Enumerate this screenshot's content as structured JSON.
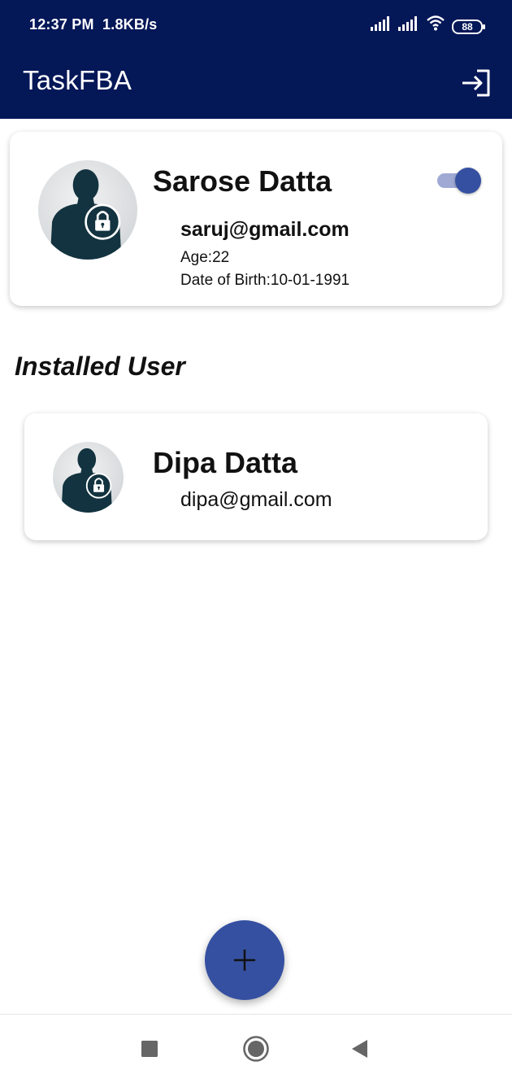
{
  "status_bar": {
    "time": "12:37 PM",
    "speed": "1.8KB/s",
    "battery": "88"
  },
  "app_bar": {
    "title": "TaskFBA",
    "logout_icon": "logout-icon"
  },
  "main_user": {
    "name": "Sarose Datta",
    "email": "saruj@gmail.com",
    "age": "Age:22",
    "dob": "Date of Birth:10-01-1991",
    "toggle_on": true
  },
  "installed_section": {
    "title": "Installed User"
  },
  "installed_users": [
    {
      "name": "Dipa Datta",
      "email": "dipa@gmail.com"
    }
  ],
  "fab": {
    "icon": "plus-icon"
  },
  "colors": {
    "primary_dark": "#041757",
    "accent": "#3550a1",
    "toggle_track": "#9fa9d4",
    "avatar_silhouette": "#12333f"
  }
}
